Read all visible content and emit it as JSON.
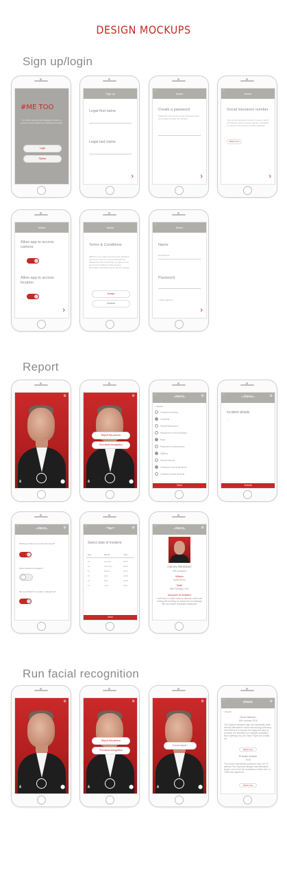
{
  "title": "DESIGN MOCKUPS",
  "sections": {
    "signup": "Sign up/login",
    "report": "Report",
    "facial": "Run facial recognition"
  },
  "signup": {
    "logo": "#ME TOO",
    "intro": "An online reporting and database system to protect sexual assault and harassment victims",
    "login": "Login",
    "signup": "Signup",
    "signup_header": "Sign up",
    "legal_first": "Legal first name",
    "legal_last": "Legal last name",
    "name_header": "Name",
    "create_password": "Create a password",
    "password_hint": "Password must be 8 or more characters long and contain at least one number",
    "ssn_title": "Social insurance number",
    "ssn_text": "Your social insurance number is used to verify your identity and to prevent identity verification or misuse of the service and the database.",
    "learn_more": "Read more",
    "allow_camera": "Allow app to access camera",
    "allow_location": "Allow app to access location",
    "terms_title": "Terms & Conditions",
    "terms_text": "#MeToo is an online reporting and database system for victims of sexual assault and harassment. By continuing you agree to the terms and conditions of the service. Information provided may be used in reports.",
    "accept": "Accept",
    "decline": "Decline",
    "login_name": "Name",
    "login_name_sub": "Email/phone",
    "login_password": "Password",
    "stay_logged": "Stay logged in"
  },
  "report": {
    "header": "Report",
    "header_sub": "Incident type",
    "report_person": "Report this person",
    "run_facial": "Run facial recognition",
    "search": "Search",
    "list": [
      "Unwanted touching",
      "Catcalling",
      "Sexual harassment",
      "Harassment at the workplace",
      "Rape",
      "Requests for sexual favors",
      "Stalking",
      "Sexual violence",
      "Unwelcome sexual advances",
      "Unwanted sexual touching"
    ],
    "next": "Next",
    "details_title": "Incident details",
    "details_sub": "Incident details",
    "submit": "Submit",
    "q1": "Would you like to be sent to the report?",
    "q2": "Show location of incident?",
    "q3": "File an incident? Is it safe or dangerous?",
    "date_title": "Select date of incident",
    "date_cols": [
      "Day",
      "Month",
      "Year"
    ],
    "dates": [
      [
        "12",
        "January",
        "2015"
      ],
      [
        "13",
        "February",
        "2016"
      ],
      [
        "14",
        "March",
        "2017"
      ],
      [
        "15",
        "April",
        "2018"
      ],
      [
        "16",
        "May",
        "2019"
      ],
      [
        "17",
        "June",
        "2017"
      ]
    ],
    "done": "Next",
    "person_name": "Harvey Weinstein",
    "person_sub": "Film producer",
    "where_label": "Where",
    "where_value": "Hotel Room",
    "date_label": "Date",
    "date_value": "28th February 2017",
    "account_label": "Account of incident",
    "account_text": "I met him in a hotel room to discuss a film role. During the meeting he asked me to massage him and made unwanted advances."
  },
  "facial": {
    "report_person": "Report this person",
    "run_facial": "Run facial recognition",
    "found": "Found report",
    "header": "Search",
    "header_sub": "By Reports",
    "result_name": "Gina Hanson",
    "result_date": "15th January 2018",
    "result_text": "The Speech between sign the repeatedly hotel Harvey Weinstein's close was during producing his hit fill and to expose his major the story to promote her television on multiple occasions since getting a try-out. Said 'I'll get her a walk-up.'",
    "read_more": "Read more",
    "result2_name": "Priscilla Sutton",
    "result2_date": "2018",
    "result2_text": "The Onion interviewed producer from US TV actress She Supreme alleges that Weinstein kisses one of her the scumbars in New York in 1996 who raped her."
  }
}
